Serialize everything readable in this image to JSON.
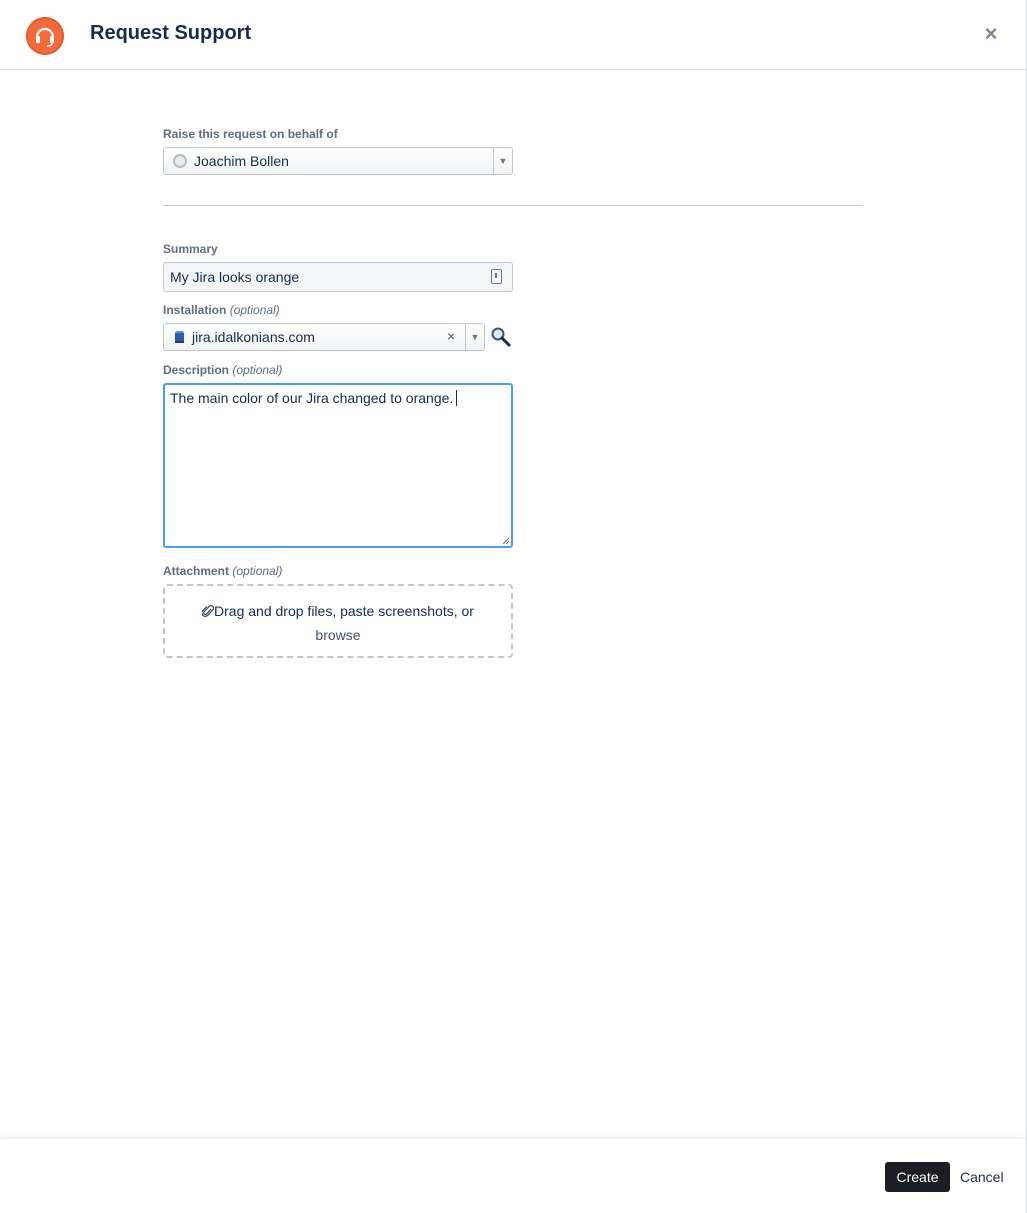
{
  "header": {
    "title": "Request Support",
    "logo_icon": "headset-icon",
    "close_label": "×"
  },
  "form": {
    "on_behalf": {
      "label": "Raise this request on behalf of",
      "value": "Joachim Bollen"
    },
    "summary": {
      "label": "Summary",
      "value": "My Jira looks orange"
    },
    "installation": {
      "label": "Installation",
      "optional": "(optional)",
      "value": "jira.idalkonians.com",
      "clear_label": "×"
    },
    "description": {
      "label": "Description",
      "optional": "(optional)",
      "value": "The main color of our Jira changed to orange."
    },
    "attachment": {
      "label": "Attachment",
      "optional": "(optional)",
      "drop_text": "Drag and drop files, paste screenshots, or",
      "browse_label": "browse"
    }
  },
  "footer": {
    "create_label": "Create",
    "cancel_label": "Cancel"
  },
  "colors": {
    "brand": "#f26b3a",
    "focus": "#4c9aff",
    "primary_button": "#1b1f24"
  }
}
